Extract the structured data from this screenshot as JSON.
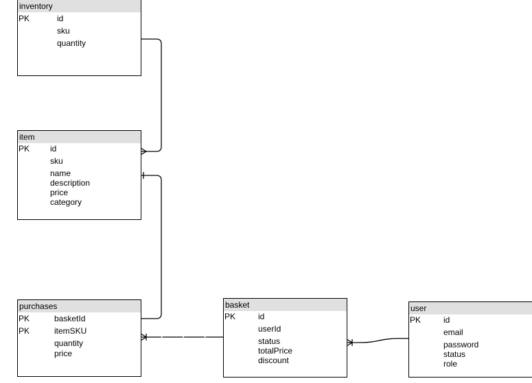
{
  "tables": {
    "inventory": {
      "title": "inventory",
      "pk": [
        "PK"
      ],
      "fields": [
        "id",
        "sku",
        "quantity"
      ]
    },
    "item": {
      "title": "item",
      "pk": [
        "PK"
      ],
      "fields": [
        "id",
        "sku",
        "name",
        "description",
        "price",
        "category"
      ]
    },
    "purchases": {
      "title": "purchases",
      "pk": [
        "PK",
        "PK"
      ],
      "fields": [
        "basketId",
        "itemSKU",
        "quantity",
        "price"
      ]
    },
    "basket": {
      "title": "basket",
      "pk": [
        "PK"
      ],
      "fields": [
        "id",
        "userId",
        "status",
        "totalPrice",
        "discount"
      ]
    },
    "user": {
      "title": "user",
      "pk": [
        "PK"
      ],
      "fields": [
        "id",
        "email",
        "password",
        "status",
        "role"
      ]
    }
  }
}
